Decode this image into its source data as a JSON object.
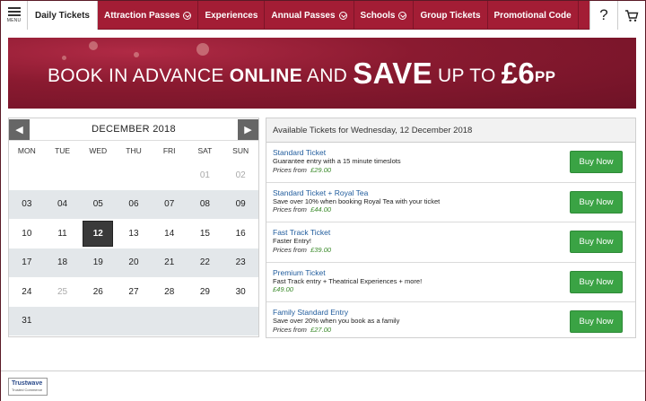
{
  "nav": {
    "menu_label": "MENU",
    "tabs": [
      {
        "label": "Daily Tickets",
        "active": true,
        "dropdown": false
      },
      {
        "label": "Attraction Passes",
        "active": false,
        "dropdown": true
      },
      {
        "label": "Experiences",
        "active": false,
        "dropdown": false
      },
      {
        "label": "Annual Passes",
        "active": false,
        "dropdown": true
      },
      {
        "label": "Schools",
        "active": false,
        "dropdown": true
      },
      {
        "label": "Group Tickets",
        "active": false,
        "dropdown": false
      },
      {
        "label": "Promotional Code",
        "active": false,
        "dropdown": false
      }
    ],
    "help_icon": "question-icon",
    "cart_icon": "cart-icon",
    "accent": "#a31d35"
  },
  "banner": {
    "part1": "BOOK IN ADVANCE ",
    "part2": "ONLINE",
    "part3": " AND ",
    "part4": "SAVE",
    "part5": " UP TO ",
    "part6": "£6",
    "part7": "PP"
  },
  "calendar": {
    "title": "DECEMBER 2018",
    "prev_icon": "chevron-left-icon",
    "next_icon": "chevron-right-icon",
    "weekdays": [
      "MON",
      "TUE",
      "WED",
      "THU",
      "FRI",
      "SAT",
      "SUN"
    ],
    "weeks": [
      [
        "",
        "",
        "",
        "",
        "",
        "01",
        "02"
      ],
      [
        "03",
        "04",
        "05",
        "06",
        "07",
        "08",
        "09"
      ],
      [
        "10",
        "11",
        "12",
        "13",
        "14",
        "15",
        "16"
      ],
      [
        "17",
        "18",
        "19",
        "20",
        "21",
        "22",
        "23"
      ],
      [
        "24",
        "25",
        "26",
        "27",
        "28",
        "29",
        "30"
      ],
      [
        "31",
        "",
        "",
        "",
        "",
        "",
        ""
      ]
    ],
    "muted_days": [
      "01",
      "02",
      "25"
    ],
    "selected_day": "12"
  },
  "tickets": {
    "heading": "Available Tickets for Wednesday, 12 December 2018",
    "items": [
      {
        "name": "Standard Ticket",
        "desc": "Guarantee entry with a 15 minute timeslots",
        "price_prefix": "Prices from",
        "price": "£29.00",
        "button": "Buy Now"
      },
      {
        "name": "Standard Ticket + Royal Tea",
        "desc": "Save over 10% when booking Royal Tea with your ticket",
        "price_prefix": "Prices from",
        "price": "£44.00",
        "button": "Buy Now"
      },
      {
        "name": "Fast Track Ticket",
        "desc": "Faster Entry!",
        "price_prefix": "Prices from",
        "price": "£39.00",
        "button": "Buy Now"
      },
      {
        "name": "Premium Ticket",
        "desc": "Fast Track entry + Theatrical Experiences + more!",
        "price_prefix": "",
        "price": "£49.00",
        "button": "Buy Now"
      },
      {
        "name": "Family Standard Entry",
        "desc": "Save over 20% when you book as a family",
        "price_prefix": "Prices from",
        "price": "£27.00",
        "button": "Buy Now"
      }
    ],
    "button_color": "#3aa344"
  },
  "footer": {
    "trust_line1": "Trustwave",
    "trust_line2": "Trusted Commerce"
  }
}
